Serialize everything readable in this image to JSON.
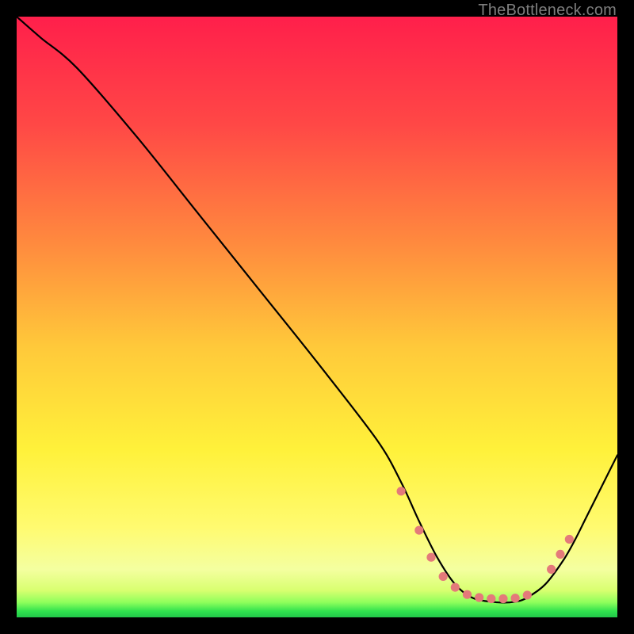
{
  "watermark": "TheBottleneck.com",
  "chart_data": {
    "type": "line",
    "title": "",
    "xlabel": "",
    "ylabel": "",
    "xlim": [
      0,
      100
    ],
    "ylim": [
      0,
      100
    ],
    "curve": {
      "x": [
        0,
        4,
        10,
        20,
        30,
        40,
        50,
        60,
        64,
        67,
        70,
        73,
        76,
        80,
        83,
        85,
        88,
        91,
        93,
        95,
        100
      ],
      "y": [
        100,
        96.5,
        91.5,
        80,
        67.5,
        55,
        42.5,
        29.5,
        22.5,
        16,
        10,
        5.5,
        3.2,
        2.5,
        2.6,
        3.3,
        5.5,
        9.5,
        13,
        17,
        27
      ]
    },
    "dots": {
      "x": [
        64,
        67,
        69,
        71,
        73,
        75,
        77,
        79,
        81,
        83,
        85,
        89,
        90.5,
        92
      ],
      "y": [
        21,
        14.5,
        10,
        6.8,
        5,
        3.8,
        3.3,
        3.1,
        3.1,
        3.2,
        3.7,
        8,
        10.5,
        13
      ]
    },
    "colors": {
      "green": "#2fe24e",
      "yellow_green": "#e8ff3a",
      "yellow": "#ffe63a",
      "yellow_soft": "#fff27a",
      "orange": "#ff9d3a",
      "red": "#ff2a4a",
      "dot": "#e47a7a"
    }
  }
}
